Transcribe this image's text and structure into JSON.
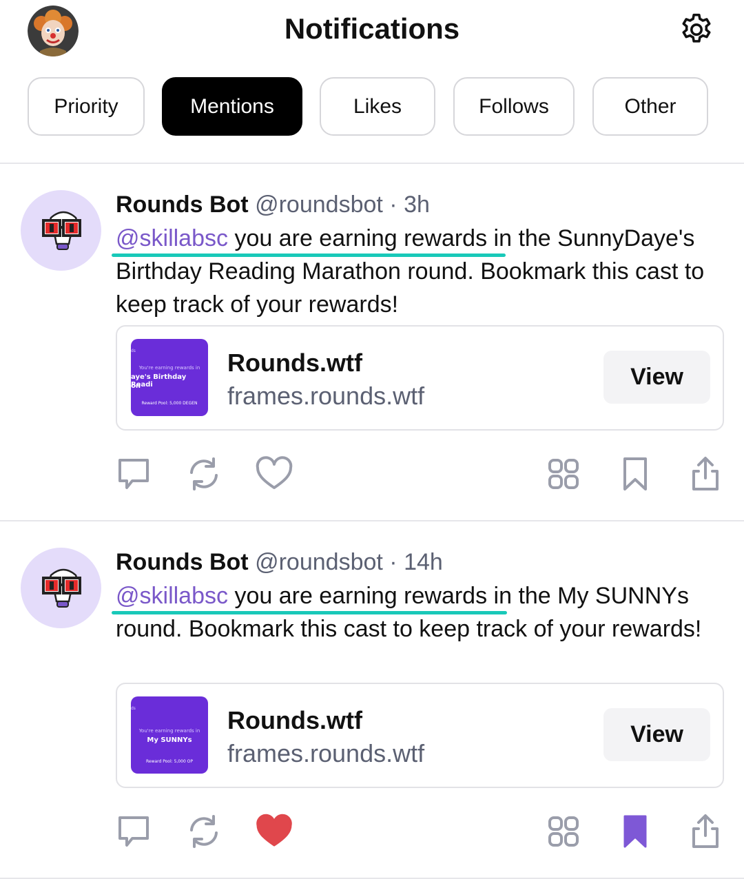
{
  "header": {
    "title": "Notifications",
    "avatar_icon": "clown-avatar",
    "settings_icon": "gear-icon"
  },
  "tabs": [
    {
      "label": "Priority",
      "active": false
    },
    {
      "label": "Mentions",
      "active": true
    },
    {
      "label": "Likes",
      "active": false
    },
    {
      "label": "Follows",
      "active": false
    },
    {
      "label": "Other",
      "active": false
    }
  ],
  "posts": [
    {
      "author": "Rounds Bot",
      "handle": "@roundsbot",
      "separator": "·",
      "time": "3h",
      "mention": "@skillabsc",
      "text_line1_rest": " you are earning rewards in the SunnyDaye's",
      "text_rest": "Birthday Reading Marathon round. Bookmark this cast to keep track of your rewards!",
      "card": {
        "title": "Rounds.wtf",
        "url": "frames.rounds.wtf",
        "button": "View",
        "thumb_top": "ds",
        "thumb_small": "You're earning rewards in",
        "thumb_big_1": "aye's Birthday Readi",
        "thumb_big_2": "on",
        "thumb_pool": "Reward Pool:  5,000 DEGEN"
      },
      "liked": false,
      "bookmarked": false
    },
    {
      "author": "Rounds Bot",
      "handle": "@roundsbot",
      "separator": "·",
      "time": "14h",
      "mention": "@skillabsc",
      "text_line1_rest": " you are earning rewards in the My SUNNYs",
      "text_rest": "round. Bookmark this cast to keep track of your rewards!",
      "card": {
        "title": "Rounds.wtf",
        "url": "frames.rounds.wtf",
        "button": "View",
        "thumb_top": "ds",
        "thumb_small": "You're earning rewards in",
        "thumb_big_1": "My SUNNYs",
        "thumb_big_2": "",
        "thumb_pool": "Reward Pool:  5,000 OP"
      },
      "liked": true,
      "bookmarked": true
    }
  ],
  "colors": {
    "accent": "#7a58c9",
    "underline": "#19c9b9",
    "like": "#e0474c",
    "bookmark": "#7e58d6",
    "icon_gray": "#9a9daa"
  }
}
